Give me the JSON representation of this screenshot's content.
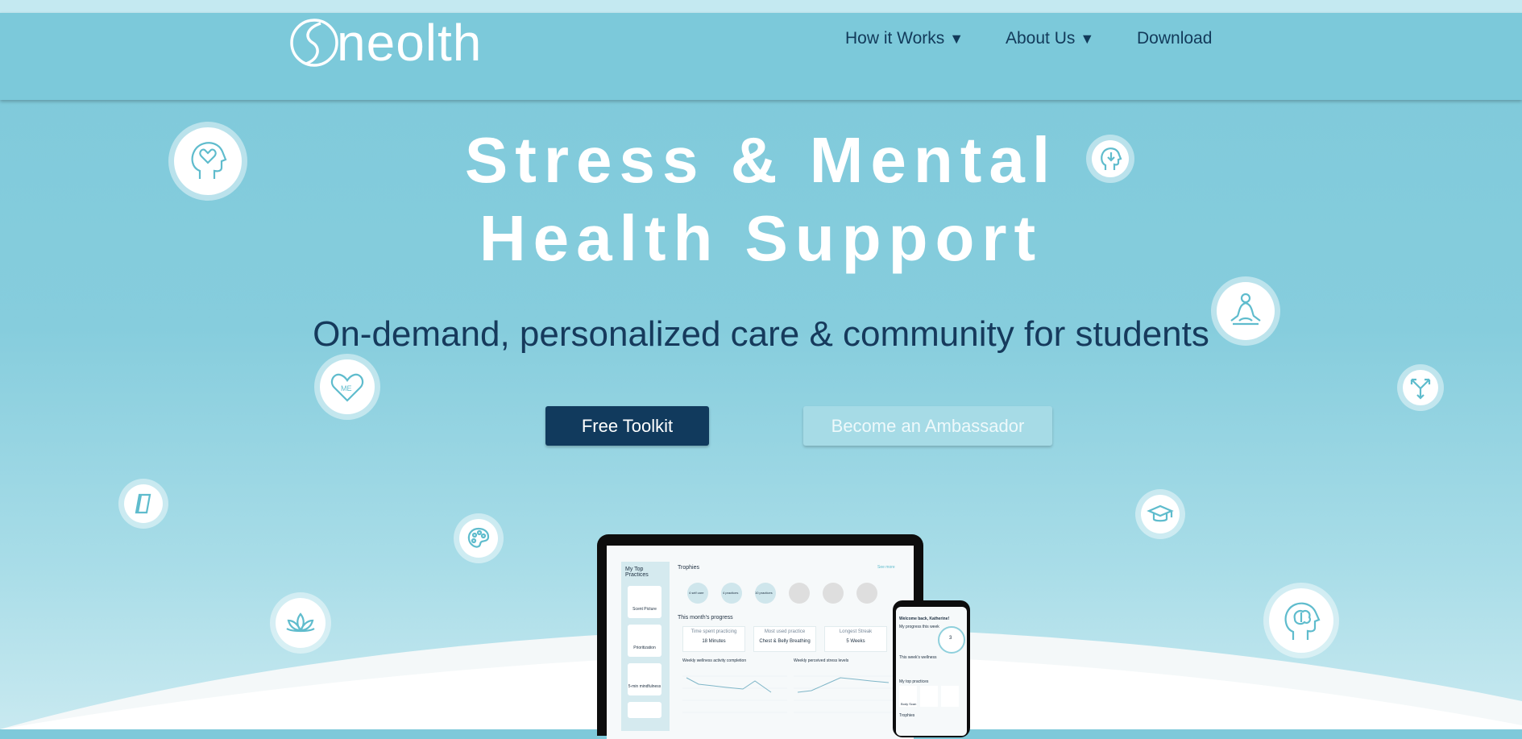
{
  "brand": {
    "logo_text": "neolth"
  },
  "nav": {
    "how_it_works": "How it Works",
    "about_us": "About Us",
    "download": "Download",
    "dropdown_glyph": "▼"
  },
  "hero": {
    "title_line1": "Stress & Mental",
    "title_line2": "Health Support",
    "subtitle": "On-demand, personalized care & community for students",
    "primary_button": "Free Toolkit",
    "secondary_button": "Become an Ambassador"
  },
  "icons": [
    "head-heart-icon",
    "head-download-icon",
    "meditation-icon",
    "heart-me-icon",
    "split-arrows-icon",
    "book-icon",
    "palette-icon",
    "graduation-cap-icon",
    "lotus-icon",
    "brain-head-icon"
  ],
  "mockup": {
    "laptop": {
      "sidebar_title": "My Top Practices",
      "trophies_label": "Trophies",
      "see_more": "See more",
      "trophy_labels": [
        "4 self care",
        "4 practices",
        "10 practices"
      ],
      "progress_label": "This month's progress",
      "stats": [
        {
          "label": "Time spent practicing",
          "value": "18 Minutes"
        },
        {
          "label": "Most used practice",
          "value": "Chest & Belly Breathing"
        },
        {
          "label": "Longest Streak",
          "value": "5 Weeks"
        }
      ],
      "chart1_title": "Weekly wellness activity completion",
      "chart2_title": "Weekly perceived stress levels",
      "practice_cards": [
        "Scent Picture",
        "Prioritization",
        "5-min mindfulness"
      ]
    },
    "phone": {
      "welcome": "Welcome back, Katherine!",
      "progress_label": "My progress this week",
      "count": "3",
      "wellness_label": "This week's wellness",
      "practices_label": "My top practices",
      "card_label": "Body Scan",
      "trophies_label": "Trophies"
    }
  },
  "colors": {
    "background": "#7ec9da",
    "header": "#7cc9da",
    "nav_text": "#123a5a",
    "primary_button": "#113a5d",
    "secondary_button": "#a6dbe6",
    "icon_stroke": "#5fbccd"
  }
}
